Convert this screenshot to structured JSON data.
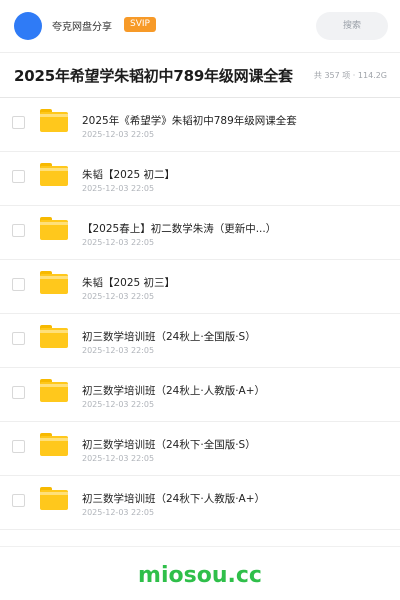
{
  "header": {
    "brand": "夸克网盘分享",
    "badge": "SVIP",
    "search_placeholder": "搜索"
  },
  "title": "2025年希望学朱韬初中789年级网课全套",
  "summary": "共 357 项 · 114.2G",
  "items": [
    {
      "name": "2025年《希望学》朱韬初中789年级网课全套",
      "date": "2025-12-03 22:05"
    },
    {
      "name": "朱韬【2025 初二】",
      "date": "2025-12-03 22:05"
    },
    {
      "name": "【2025春上】初二数学朱涛（更新中...）",
      "date": "2025-12-03 22:05"
    },
    {
      "name": "朱韬【2025 初三】",
      "date": "2025-12-03 22:05"
    },
    {
      "name": "初三数学培训班（24秋上·全国版·S）",
      "date": "2025-12-03 22:05"
    },
    {
      "name": "初三数学培训班（24秋上·人教版·A+）",
      "date": "2025-12-03 22:05"
    },
    {
      "name": "初三数学培训班（24秋下·全国版·S）",
      "date": "2025-12-03 22:05"
    },
    {
      "name": "初三数学培训班（24秋下·人教版·A+）",
      "date": "2025-12-03 22:05"
    }
  ],
  "footer": {
    "watermark": "miosou.cc"
  },
  "colors": {
    "avatar": "#2f7bf6",
    "badge": "#f79a28",
    "folder": "#ffc81c",
    "watermark": "#2fbf4a"
  }
}
